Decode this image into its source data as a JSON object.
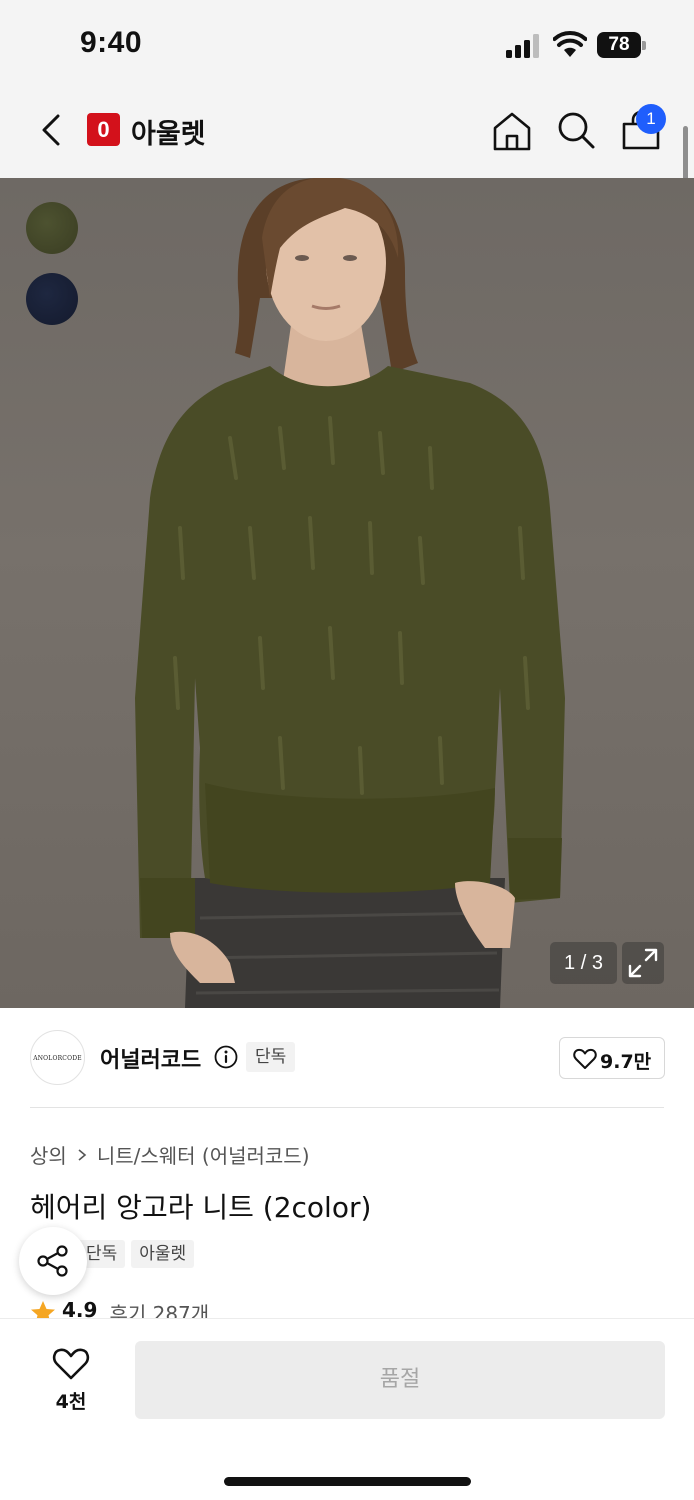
{
  "status": {
    "time": "9:40",
    "battery": "78"
  },
  "header": {
    "brand_logo": "0",
    "brand_name": "아울렛",
    "cart_count": "1"
  },
  "hero": {
    "image_counter": "1 / 3",
    "color_swatches": [
      "#44482a",
      "#182035"
    ]
  },
  "brand": {
    "avatar_text": "ANOLORCODE",
    "name": "어널러코드",
    "exclusive_tag": "단독",
    "favorite_count": "9.7만"
  },
  "product": {
    "breadcrumb": [
      "상의",
      "니트/스웨터 (어널러코드)"
    ],
    "title": "헤어리 앙고라 니트 (2color)",
    "tags": [
      "단독",
      "아울렛"
    ],
    "rating": "4.9",
    "review_count": "후기 287개"
  },
  "bottom": {
    "like_count": "4천",
    "soldout_label": "품절"
  },
  "colors": {
    "accent_red": "#d3111b",
    "badge_blue": "#1f5efc",
    "star": "#f5a623"
  }
}
